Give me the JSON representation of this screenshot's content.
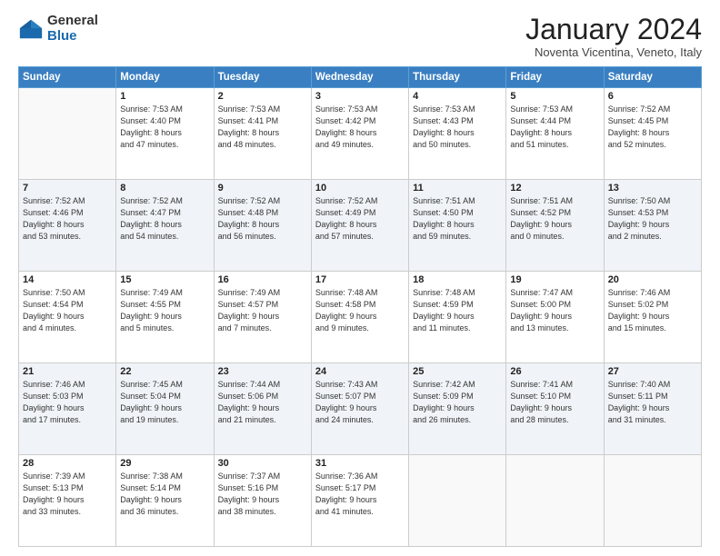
{
  "logo": {
    "general": "General",
    "blue": "Blue"
  },
  "header": {
    "title": "January 2024",
    "subtitle": "Noventa Vicentina, Veneto, Italy"
  },
  "weekdays": [
    "Sunday",
    "Monday",
    "Tuesday",
    "Wednesday",
    "Thursday",
    "Friday",
    "Saturday"
  ],
  "weeks": [
    [
      {
        "day": "",
        "info": ""
      },
      {
        "day": "1",
        "info": "Sunrise: 7:53 AM\nSunset: 4:40 PM\nDaylight: 8 hours\nand 47 minutes."
      },
      {
        "day": "2",
        "info": "Sunrise: 7:53 AM\nSunset: 4:41 PM\nDaylight: 8 hours\nand 48 minutes."
      },
      {
        "day": "3",
        "info": "Sunrise: 7:53 AM\nSunset: 4:42 PM\nDaylight: 8 hours\nand 49 minutes."
      },
      {
        "day": "4",
        "info": "Sunrise: 7:53 AM\nSunset: 4:43 PM\nDaylight: 8 hours\nand 50 minutes."
      },
      {
        "day": "5",
        "info": "Sunrise: 7:53 AM\nSunset: 4:44 PM\nDaylight: 8 hours\nand 51 minutes."
      },
      {
        "day": "6",
        "info": "Sunrise: 7:52 AM\nSunset: 4:45 PM\nDaylight: 8 hours\nand 52 minutes."
      }
    ],
    [
      {
        "day": "7",
        "info": "Sunrise: 7:52 AM\nSunset: 4:46 PM\nDaylight: 8 hours\nand 53 minutes."
      },
      {
        "day": "8",
        "info": "Sunrise: 7:52 AM\nSunset: 4:47 PM\nDaylight: 8 hours\nand 54 minutes."
      },
      {
        "day": "9",
        "info": "Sunrise: 7:52 AM\nSunset: 4:48 PM\nDaylight: 8 hours\nand 56 minutes."
      },
      {
        "day": "10",
        "info": "Sunrise: 7:52 AM\nSunset: 4:49 PM\nDaylight: 8 hours\nand 57 minutes."
      },
      {
        "day": "11",
        "info": "Sunrise: 7:51 AM\nSunset: 4:50 PM\nDaylight: 8 hours\nand 59 minutes."
      },
      {
        "day": "12",
        "info": "Sunrise: 7:51 AM\nSunset: 4:52 PM\nDaylight: 9 hours\nand 0 minutes."
      },
      {
        "day": "13",
        "info": "Sunrise: 7:50 AM\nSunset: 4:53 PM\nDaylight: 9 hours\nand 2 minutes."
      }
    ],
    [
      {
        "day": "14",
        "info": "Sunrise: 7:50 AM\nSunset: 4:54 PM\nDaylight: 9 hours\nand 4 minutes."
      },
      {
        "day": "15",
        "info": "Sunrise: 7:49 AM\nSunset: 4:55 PM\nDaylight: 9 hours\nand 5 minutes."
      },
      {
        "day": "16",
        "info": "Sunrise: 7:49 AM\nSunset: 4:57 PM\nDaylight: 9 hours\nand 7 minutes."
      },
      {
        "day": "17",
        "info": "Sunrise: 7:48 AM\nSunset: 4:58 PM\nDaylight: 9 hours\nand 9 minutes."
      },
      {
        "day": "18",
        "info": "Sunrise: 7:48 AM\nSunset: 4:59 PM\nDaylight: 9 hours\nand 11 minutes."
      },
      {
        "day": "19",
        "info": "Sunrise: 7:47 AM\nSunset: 5:00 PM\nDaylight: 9 hours\nand 13 minutes."
      },
      {
        "day": "20",
        "info": "Sunrise: 7:46 AM\nSunset: 5:02 PM\nDaylight: 9 hours\nand 15 minutes."
      }
    ],
    [
      {
        "day": "21",
        "info": "Sunrise: 7:46 AM\nSunset: 5:03 PM\nDaylight: 9 hours\nand 17 minutes."
      },
      {
        "day": "22",
        "info": "Sunrise: 7:45 AM\nSunset: 5:04 PM\nDaylight: 9 hours\nand 19 minutes."
      },
      {
        "day": "23",
        "info": "Sunrise: 7:44 AM\nSunset: 5:06 PM\nDaylight: 9 hours\nand 21 minutes."
      },
      {
        "day": "24",
        "info": "Sunrise: 7:43 AM\nSunset: 5:07 PM\nDaylight: 9 hours\nand 24 minutes."
      },
      {
        "day": "25",
        "info": "Sunrise: 7:42 AM\nSunset: 5:09 PM\nDaylight: 9 hours\nand 26 minutes."
      },
      {
        "day": "26",
        "info": "Sunrise: 7:41 AM\nSunset: 5:10 PM\nDaylight: 9 hours\nand 28 minutes."
      },
      {
        "day": "27",
        "info": "Sunrise: 7:40 AM\nSunset: 5:11 PM\nDaylight: 9 hours\nand 31 minutes."
      }
    ],
    [
      {
        "day": "28",
        "info": "Sunrise: 7:39 AM\nSunset: 5:13 PM\nDaylight: 9 hours\nand 33 minutes."
      },
      {
        "day": "29",
        "info": "Sunrise: 7:38 AM\nSunset: 5:14 PM\nDaylight: 9 hours\nand 36 minutes."
      },
      {
        "day": "30",
        "info": "Sunrise: 7:37 AM\nSunset: 5:16 PM\nDaylight: 9 hours\nand 38 minutes."
      },
      {
        "day": "31",
        "info": "Sunrise: 7:36 AM\nSunset: 5:17 PM\nDaylight: 9 hours\nand 41 minutes."
      },
      {
        "day": "",
        "info": ""
      },
      {
        "day": "",
        "info": ""
      },
      {
        "day": "",
        "info": ""
      }
    ]
  ]
}
